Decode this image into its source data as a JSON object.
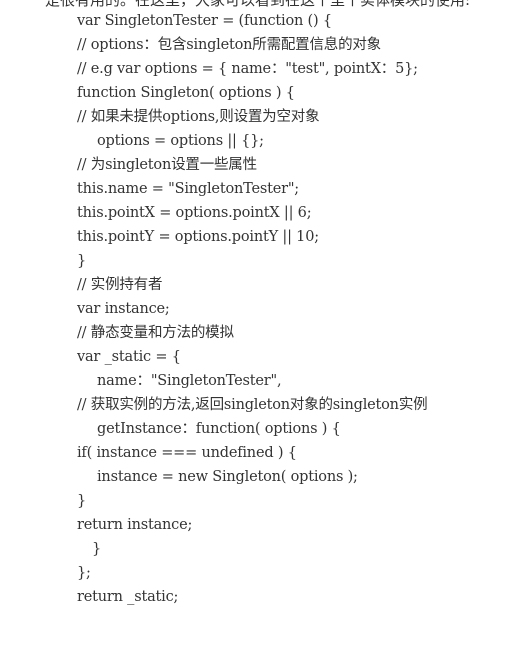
{
  "intro_text": "是很有用的。在这里，大家可以看到在这个里个实体模块的使用:",
  "code_lines": [
    "var SingletonTester = (function () {",
    "// options：包含singleton所需配置信息的对象",
    "// e.g var options = { name：\"test\", pointX：5};",
    "function Singleton( options ) {",
    "// 如果未提供options,则设置为空对象",
    "options = options || {};",
    "// 为singleton设置一些属性",
    "this.name = \"SingletonTester\";",
    "this.pointX = options.pointX || 6;",
    "this.pointY = options.pointY || 10;",
    "}",
    "// 实例持有者",
    "var instance;",
    "// 静态变量和方法的模拟",
    "var _static = {",
    "name：\"SingletonTester\",",
    "// 获取实例的方法,返回singleton对象的singleton实例",
    "getInstance：function( options ) {",
    "if( instance === undefined ) {",
    "instance = new Singleton( options );",
    "}",
    "return instance;",
    "}",
    "};",
    "return _static;"
  ]
}
